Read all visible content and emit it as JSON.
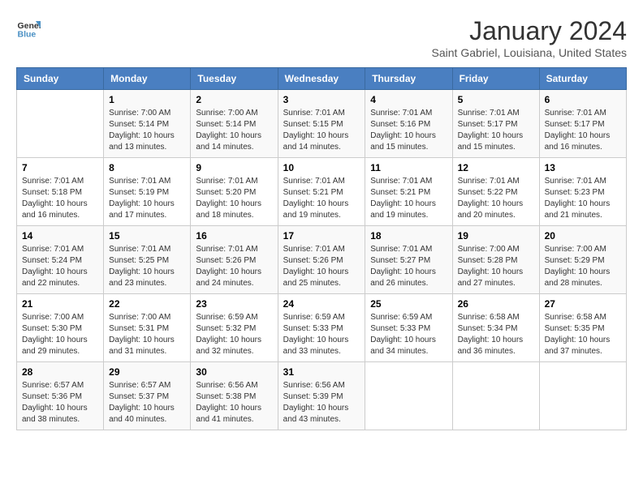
{
  "header": {
    "logo_line1": "General",
    "logo_line2": "Blue",
    "month": "January 2024",
    "location": "Saint Gabriel, Louisiana, United States"
  },
  "days_of_week": [
    "Sunday",
    "Monday",
    "Tuesday",
    "Wednesday",
    "Thursday",
    "Friday",
    "Saturday"
  ],
  "weeks": [
    [
      {
        "num": "",
        "info": ""
      },
      {
        "num": "1",
        "info": "Sunrise: 7:00 AM\nSunset: 5:14 PM\nDaylight: 10 hours\nand 13 minutes."
      },
      {
        "num": "2",
        "info": "Sunrise: 7:00 AM\nSunset: 5:14 PM\nDaylight: 10 hours\nand 14 minutes."
      },
      {
        "num": "3",
        "info": "Sunrise: 7:01 AM\nSunset: 5:15 PM\nDaylight: 10 hours\nand 14 minutes."
      },
      {
        "num": "4",
        "info": "Sunrise: 7:01 AM\nSunset: 5:16 PM\nDaylight: 10 hours\nand 15 minutes."
      },
      {
        "num": "5",
        "info": "Sunrise: 7:01 AM\nSunset: 5:17 PM\nDaylight: 10 hours\nand 15 minutes."
      },
      {
        "num": "6",
        "info": "Sunrise: 7:01 AM\nSunset: 5:17 PM\nDaylight: 10 hours\nand 16 minutes."
      }
    ],
    [
      {
        "num": "7",
        "info": "Sunrise: 7:01 AM\nSunset: 5:18 PM\nDaylight: 10 hours\nand 16 minutes."
      },
      {
        "num": "8",
        "info": "Sunrise: 7:01 AM\nSunset: 5:19 PM\nDaylight: 10 hours\nand 17 minutes."
      },
      {
        "num": "9",
        "info": "Sunrise: 7:01 AM\nSunset: 5:20 PM\nDaylight: 10 hours\nand 18 minutes."
      },
      {
        "num": "10",
        "info": "Sunrise: 7:01 AM\nSunset: 5:21 PM\nDaylight: 10 hours\nand 19 minutes."
      },
      {
        "num": "11",
        "info": "Sunrise: 7:01 AM\nSunset: 5:21 PM\nDaylight: 10 hours\nand 19 minutes."
      },
      {
        "num": "12",
        "info": "Sunrise: 7:01 AM\nSunset: 5:22 PM\nDaylight: 10 hours\nand 20 minutes."
      },
      {
        "num": "13",
        "info": "Sunrise: 7:01 AM\nSunset: 5:23 PM\nDaylight: 10 hours\nand 21 minutes."
      }
    ],
    [
      {
        "num": "14",
        "info": "Sunrise: 7:01 AM\nSunset: 5:24 PM\nDaylight: 10 hours\nand 22 minutes."
      },
      {
        "num": "15",
        "info": "Sunrise: 7:01 AM\nSunset: 5:25 PM\nDaylight: 10 hours\nand 23 minutes."
      },
      {
        "num": "16",
        "info": "Sunrise: 7:01 AM\nSunset: 5:26 PM\nDaylight: 10 hours\nand 24 minutes."
      },
      {
        "num": "17",
        "info": "Sunrise: 7:01 AM\nSunset: 5:26 PM\nDaylight: 10 hours\nand 25 minutes."
      },
      {
        "num": "18",
        "info": "Sunrise: 7:01 AM\nSunset: 5:27 PM\nDaylight: 10 hours\nand 26 minutes."
      },
      {
        "num": "19",
        "info": "Sunrise: 7:00 AM\nSunset: 5:28 PM\nDaylight: 10 hours\nand 27 minutes."
      },
      {
        "num": "20",
        "info": "Sunrise: 7:00 AM\nSunset: 5:29 PM\nDaylight: 10 hours\nand 28 minutes."
      }
    ],
    [
      {
        "num": "21",
        "info": "Sunrise: 7:00 AM\nSunset: 5:30 PM\nDaylight: 10 hours\nand 29 minutes."
      },
      {
        "num": "22",
        "info": "Sunrise: 7:00 AM\nSunset: 5:31 PM\nDaylight: 10 hours\nand 31 minutes."
      },
      {
        "num": "23",
        "info": "Sunrise: 6:59 AM\nSunset: 5:32 PM\nDaylight: 10 hours\nand 32 minutes."
      },
      {
        "num": "24",
        "info": "Sunrise: 6:59 AM\nSunset: 5:33 PM\nDaylight: 10 hours\nand 33 minutes."
      },
      {
        "num": "25",
        "info": "Sunrise: 6:59 AM\nSunset: 5:33 PM\nDaylight: 10 hours\nand 34 minutes."
      },
      {
        "num": "26",
        "info": "Sunrise: 6:58 AM\nSunset: 5:34 PM\nDaylight: 10 hours\nand 36 minutes."
      },
      {
        "num": "27",
        "info": "Sunrise: 6:58 AM\nSunset: 5:35 PM\nDaylight: 10 hours\nand 37 minutes."
      }
    ],
    [
      {
        "num": "28",
        "info": "Sunrise: 6:57 AM\nSunset: 5:36 PM\nDaylight: 10 hours\nand 38 minutes."
      },
      {
        "num": "29",
        "info": "Sunrise: 6:57 AM\nSunset: 5:37 PM\nDaylight: 10 hours\nand 40 minutes."
      },
      {
        "num": "30",
        "info": "Sunrise: 6:56 AM\nSunset: 5:38 PM\nDaylight: 10 hours\nand 41 minutes."
      },
      {
        "num": "31",
        "info": "Sunrise: 6:56 AM\nSunset: 5:39 PM\nDaylight: 10 hours\nand 43 minutes."
      },
      {
        "num": "",
        "info": ""
      },
      {
        "num": "",
        "info": ""
      },
      {
        "num": "",
        "info": ""
      }
    ]
  ]
}
